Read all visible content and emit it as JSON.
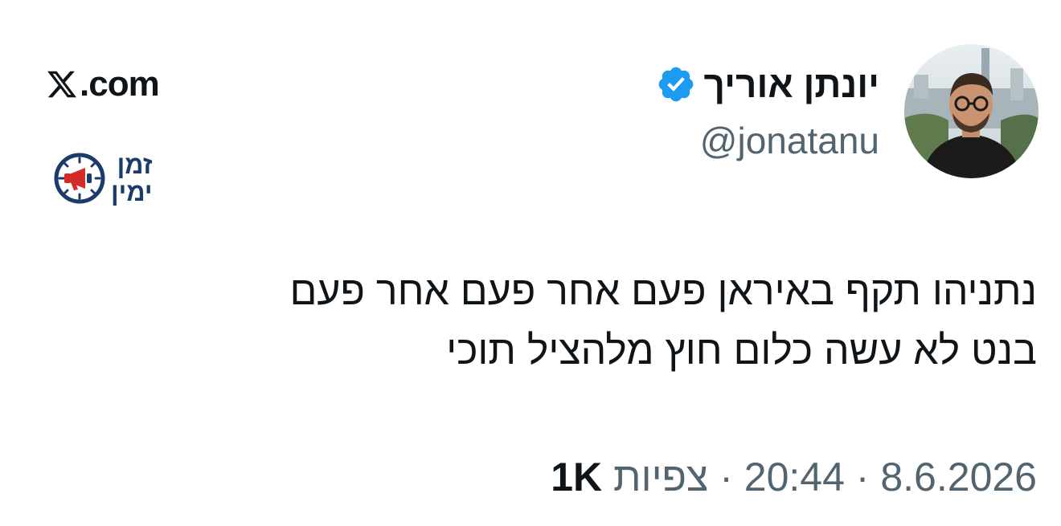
{
  "author": {
    "name": "יונתן אוריך",
    "handle": "@jonatanu",
    "verified": true
  },
  "site": {
    "domain": ".com",
    "logo_icon": "x-logo-icon"
  },
  "logo": {
    "line1": "זמן",
    "line2": "ימין",
    "icon": "megaphone-clock-icon"
  },
  "tweet": {
    "text_line1": "נתניהו תקף באיראן פעם אחר פעם אחר פעם",
    "text_line2": "בנט לא עשה כלום חוץ מלהציל תוכי"
  },
  "meta": {
    "date": "8.6.2026",
    "sep1": "·",
    "time": "20:44",
    "sep2": "·",
    "views_label": "צפיות",
    "views_count": "1K"
  },
  "colors": {
    "verified_blue": "#1d9bf0",
    "secondary_text": "#536471",
    "primary_text": "#0f1419",
    "logo_navy": "#1b3b6a",
    "logo_red": "#d42a2a"
  }
}
